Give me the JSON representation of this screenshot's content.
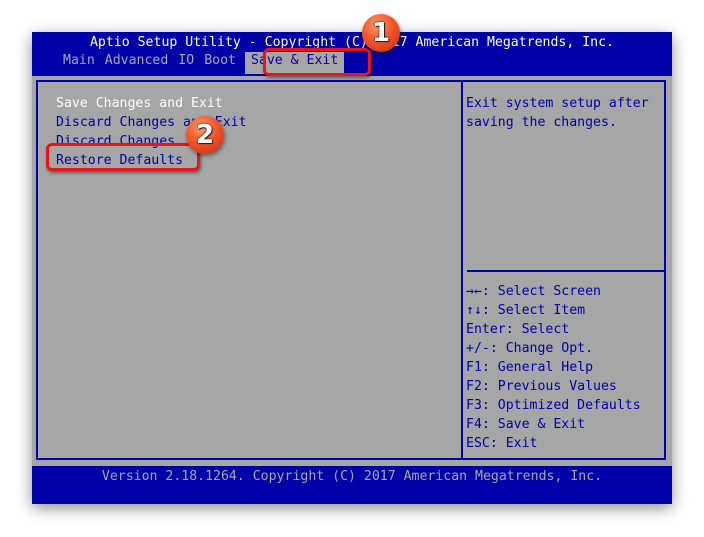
{
  "header": {
    "title": "Aptio Setup Utility - Copyright (C) 2017 American Megatrends, Inc.",
    "tabs": [
      {
        "label": "Main",
        "active": false
      },
      {
        "label": "Advanced",
        "active": false
      },
      {
        "label": "IO",
        "active": false
      },
      {
        "label": "Boot",
        "active": false
      },
      {
        "label": "Save & Exit",
        "active": true
      }
    ]
  },
  "menu": {
    "items": [
      {
        "label": "Save Changes and Exit",
        "selected": true
      },
      {
        "label": "Discard Changes and Exit",
        "selected": false
      },
      {
        "label": "Discard Changes",
        "selected": false
      },
      {
        "label": "Restore Defaults",
        "selected": false
      }
    ]
  },
  "help": {
    "text": "Exit system setup after\nsaving the changes."
  },
  "keys": [
    "→←: Select Screen",
    "↑↓: Select Item",
    "Enter: Select",
    "+/-: Change Opt.",
    "F1: General Help",
    "F2: Previous Values",
    "F3: Optimized Defaults",
    "F4: Save & Exit",
    "ESC: Exit"
  ],
  "footer": {
    "text": "Version 2.18.1264. Copyright (C) 2017 American Megatrends, Inc."
  },
  "annotations": {
    "badge1": "1",
    "badge2": "2"
  },
  "colors": {
    "bios_blue": "#0000a8",
    "bios_gray": "#a6a6a6",
    "annotation_red": "#e8141a"
  }
}
